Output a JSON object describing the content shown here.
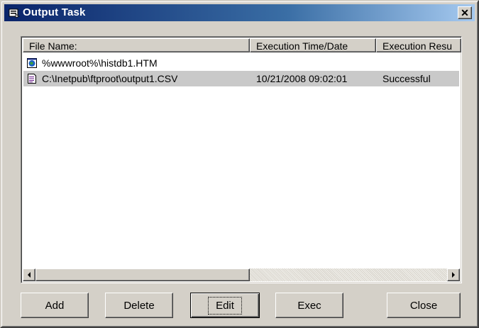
{
  "window": {
    "title": "Output Task"
  },
  "list": {
    "columns": [
      "File Name:",
      "Execution Time/Date",
      "Execution Resu"
    ],
    "rows": [
      {
        "file": "%wwwroot%\\histdb1.HTM",
        "time": "",
        "result": "",
        "icon": "html-file-icon"
      },
      {
        "file": "C:\\Inetpub\\ftproot\\output1.CSV",
        "time": "10/21/2008 09:02:01",
        "result": "Successful",
        "icon": "text-file-icon"
      }
    ],
    "selected_row": 1,
    "hscroll_position": 0.0
  },
  "buttons": {
    "add": "Add",
    "delete": "Delete",
    "edit": "Edit",
    "exec": "Exec",
    "close": "Close"
  },
  "colors": {
    "titlebar_start": "#0a246a",
    "titlebar_end": "#a6caf0",
    "face": "#d4d0c8",
    "selection": "#c9c9c9"
  }
}
